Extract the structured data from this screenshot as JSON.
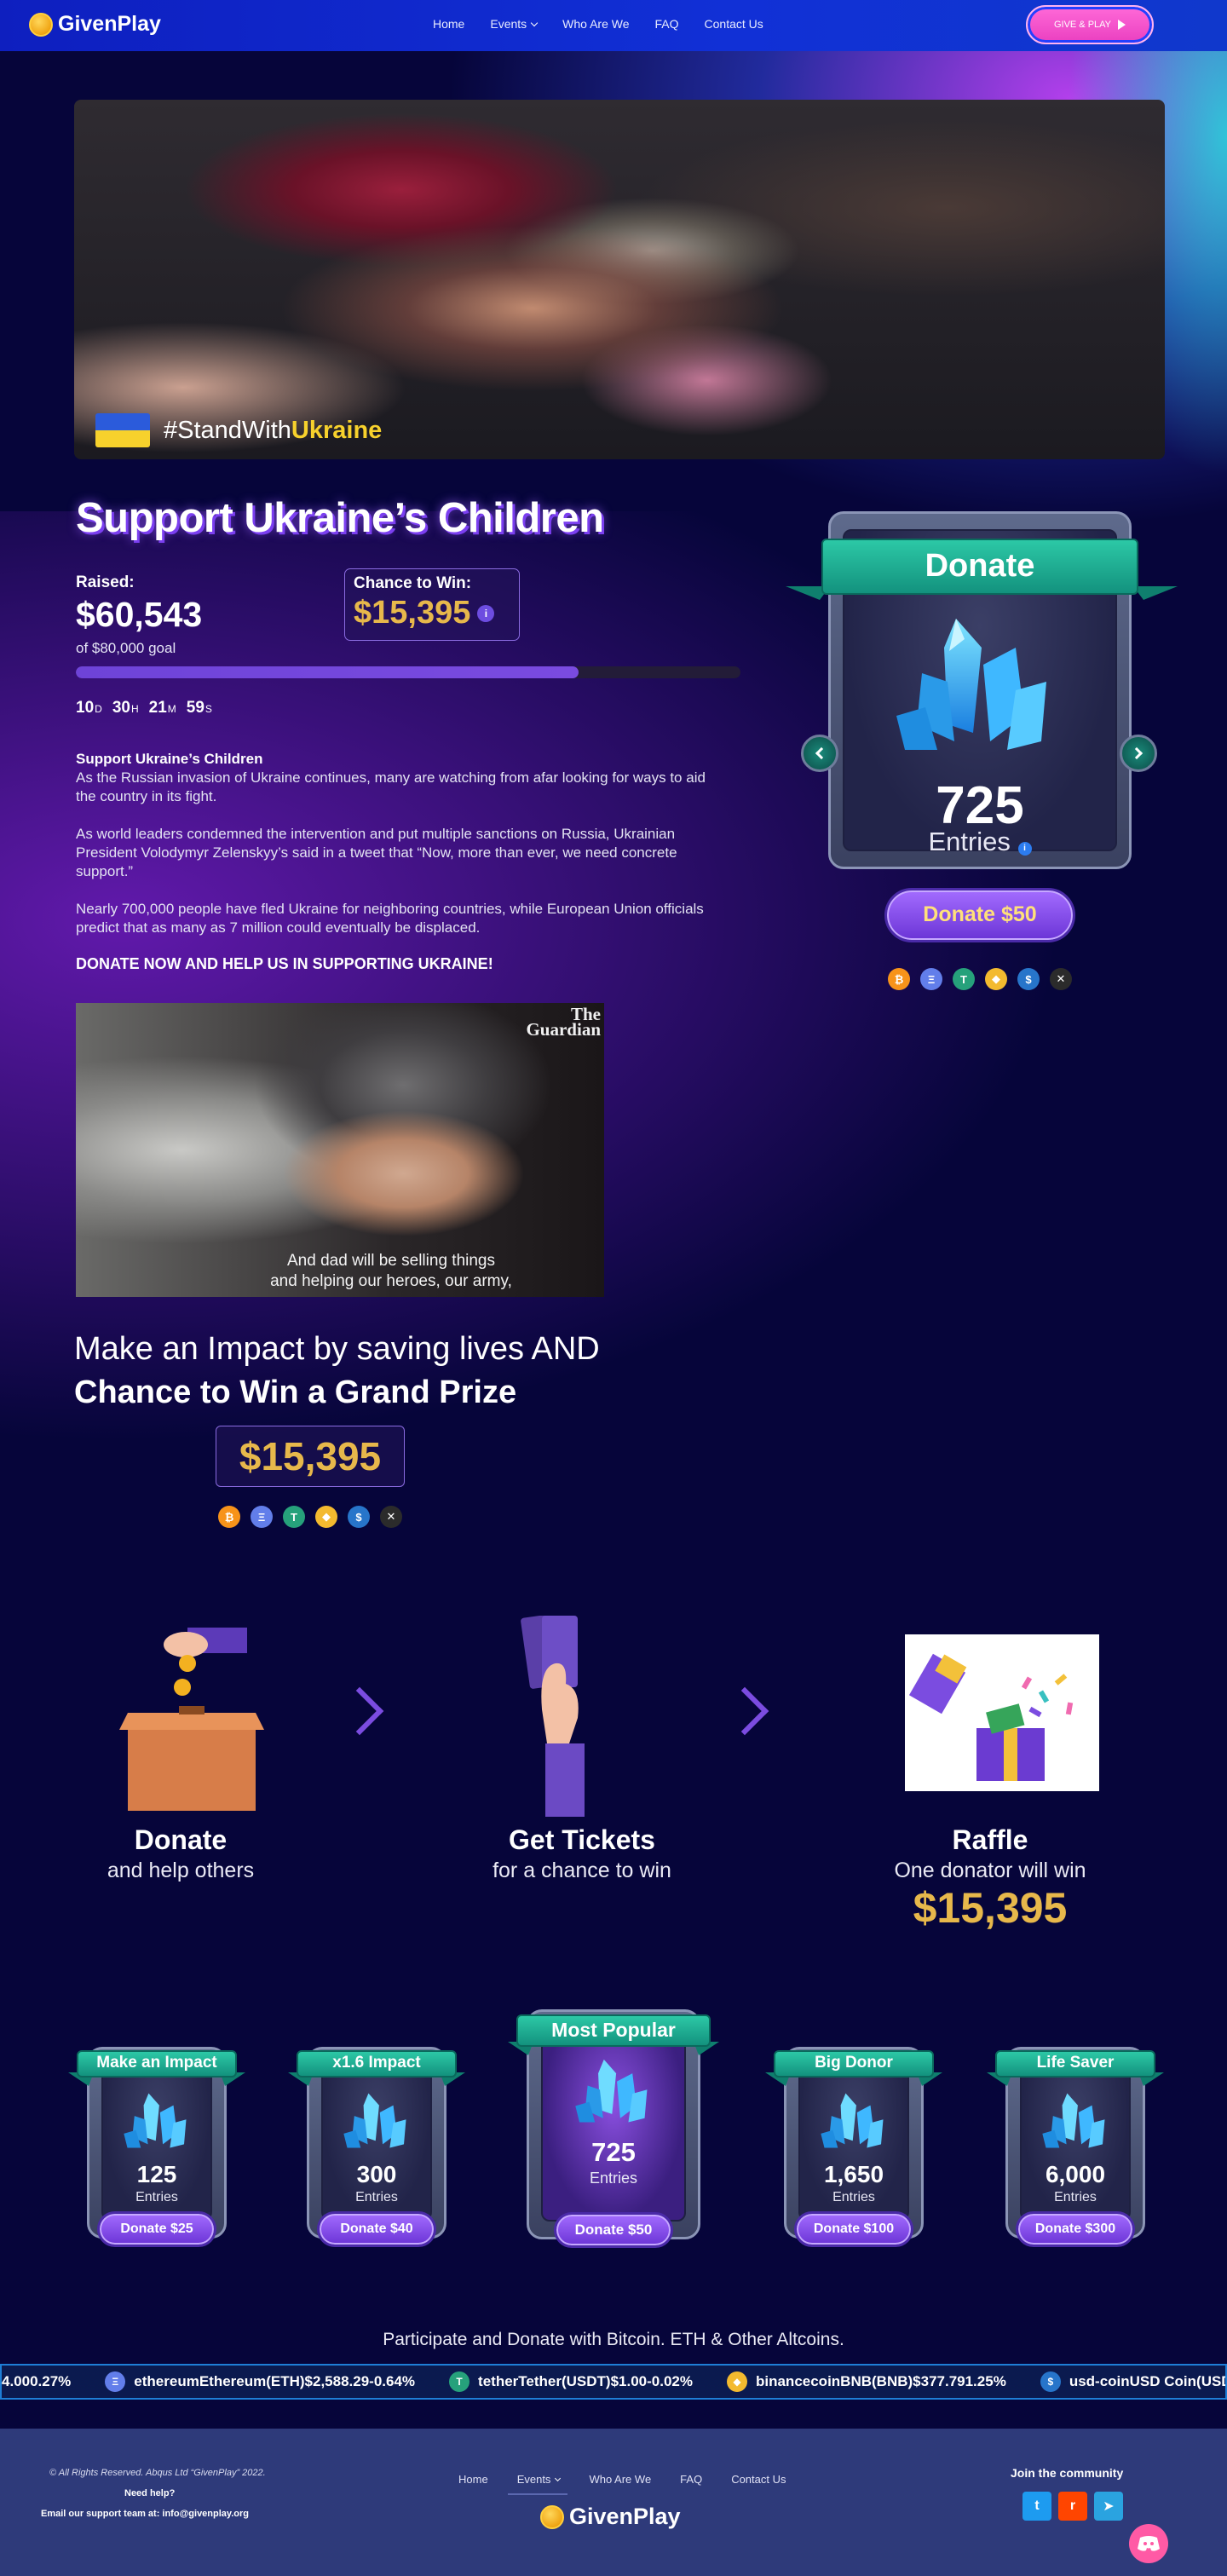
{
  "nav": {
    "logo": "GivenPlay",
    "links": [
      "Home",
      "Events",
      "Who Are We",
      "FAQ",
      "Contact Us"
    ],
    "cta": "GIVE & PLAY"
  },
  "hero": {
    "hashtag_prefix": "#StandWith",
    "hashtag_highlight": "Ukraine"
  },
  "campaign": {
    "title": "Support Ukraine’s Children",
    "raised_label": "Raised:",
    "raised_value": "$60,543",
    "goal": "of $80,000 goal",
    "progress_fraction": 0.757,
    "chance_label": "Chance to Win:",
    "chance_value": "$15,395",
    "countdown": {
      "d": "10",
      "d_unit": "D",
      "h": "30",
      "h_unit": "H",
      "m": "21",
      "m_unit": "M",
      "s": "59",
      "s_unit": "S"
    },
    "desc_heading": "Support Ukraine’s Children",
    "desc_p1": "As the Russian invasion of Ukraine continues, many are watching from afar looking for ways to aid the country in its fight.",
    "desc_p2": "As world leaders condemned the intervention and put multiple sanctions on Russia, Ukrainian President Volodymyr Zelenskyy’s said in a tweet that “Now, more than ever, we need concrete support.”",
    "desc_p3": "Nearly 700,000 people have fled Ukraine for neighboring countries, while European Union officials predict that as many as 7 million could eventually be displaced.",
    "cta": "DONATE NOW AND HELP US IN SUPPORTING UKRAINE!"
  },
  "video": {
    "brand_line1": "The",
    "brand_line2": "Guardian",
    "subtitle_line1": "And dad will be selling things",
    "subtitle_line2": "and helping our heroes, our army,"
  },
  "donate_card": {
    "ribbon": "Donate",
    "entries_count": "725",
    "entries_label": "Entries",
    "button": "Donate $50"
  },
  "crypto_icons": [
    "bitcoin-icon",
    "ethereum-icon",
    "tether-icon",
    "binance-icon",
    "usd-coin-icon",
    "xrp-icon"
  ],
  "impact": {
    "line1": "Make an Impact by saving lives AND",
    "line2": "Chance to Win a Grand Prize",
    "prize": "$15,395"
  },
  "steps": [
    {
      "title": "Donate",
      "sub": "and help others"
    },
    {
      "title": "Get Tickets",
      "sub": "for a chance to win"
    },
    {
      "title": "Raffle",
      "sub": "One donator will win",
      "prize": "$15,395"
    }
  ],
  "tiers": [
    {
      "ribbon": "Make an Impact",
      "count": "125",
      "label": "Entries",
      "button": "Donate $25"
    },
    {
      "ribbon": "x1.6 Impact",
      "count": "300",
      "label": "Entries",
      "button": "Donate $40"
    },
    {
      "ribbon": "Most Popular",
      "count": "725",
      "label": "Entries",
      "button": "Donate $50"
    },
    {
      "ribbon": "Big Donor",
      "count": "1,650",
      "label": "Entries",
      "button": "Donate $100"
    },
    {
      "ribbon": "Life Saver",
      "count": "6,000",
      "label": "Entries",
      "button": "Donate $300"
    }
  ],
  "participate": "Participate and Donate with Bitcoin. ETH & Other Altcoins.",
  "ticker": [
    {
      "text": "4.000.27%",
      "icon": ""
    },
    {
      "text": "ethereumEthereum(ETH)$2,588.29-0.64%",
      "icon": "ethereum-icon"
    },
    {
      "text": "tetherTether(USDT)$1.00-0.02%",
      "icon": "tether-icon"
    },
    {
      "text": "binancecoinBNB(BNB)$377.791.25%",
      "icon": "binance-icon"
    },
    {
      "text": "usd-coinUSD Coin(USDC",
      "icon": "usd-coin-icon"
    }
  ],
  "footer": {
    "copyright": "© All Rights Reserved. Abqus Ltd “GivenPlay”  2022.",
    "help": "Need help?",
    "email": "Email our support team at: info@givenplay.org",
    "links": [
      "Home",
      "Events",
      "Who Are We",
      "FAQ",
      "Contact Us"
    ],
    "logo": "GivenPlay",
    "join": "Join the community",
    "socials": [
      "twitter-icon",
      "reddit-icon",
      "telegram-icon"
    ]
  },
  "colors": {
    "background": "#06053a",
    "nav": "#1130d6",
    "accent_purple": "#6e43d8",
    "gold": "#e7b84b",
    "teal": "#2cc8a6",
    "pink_button": "#ea3fc0"
  }
}
